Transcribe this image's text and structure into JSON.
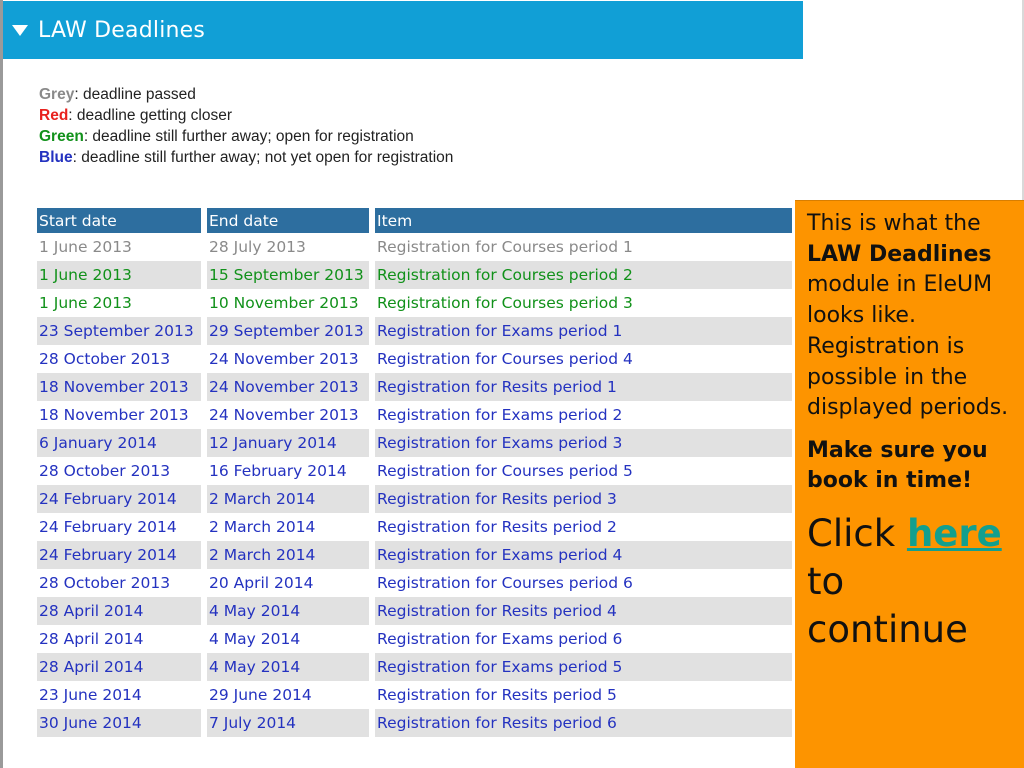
{
  "module": {
    "title": "LAW Deadlines"
  },
  "legend": [
    {
      "label": "Grey",
      "desc": ": deadline passed",
      "color": "#8a8a8a"
    },
    {
      "label": "Red",
      "desc": ": deadline getting closer",
      "color": "#e8221e"
    },
    {
      "label": "Green",
      "desc": ": deadline still further away; open for registration",
      "color": "#11911a"
    },
    {
      "label": "Blue",
      "desc": ": deadline still further away; not yet open for registration",
      "color": "#2432c0"
    }
  ],
  "table": {
    "headers": [
      "Start date",
      "End date",
      "Item"
    ],
    "header_color": "#2d6e9f",
    "rows": [
      {
        "start": "1 June 2013",
        "end": "28 July 2013",
        "item": "Registration for Courses period 1",
        "status": "grey"
      },
      {
        "start": "1 June 2013",
        "end": "15 September 2013",
        "item": "Registration for Courses period 2",
        "status": "green"
      },
      {
        "start": "1 June 2013",
        "end": "10 November 2013",
        "item": "Registration for Courses period 3",
        "status": "green"
      },
      {
        "start": "23 September 2013",
        "end": "29 September 2013",
        "item": "Registration for Exams period 1",
        "status": "blue"
      },
      {
        "start": "28 October 2013",
        "end": "24 November 2013",
        "item": "Registration for Courses period 4",
        "status": "blue"
      },
      {
        "start": "18 November 2013",
        "end": "24 November 2013",
        "item": "Registration for Resits period 1",
        "status": "blue"
      },
      {
        "start": "18 November 2013",
        "end": "24 November 2013",
        "item": "Registration for Exams period 2",
        "status": "blue"
      },
      {
        "start": "6 January 2014",
        "end": "12 January 2014",
        "item": "Registration for Exams period 3",
        "status": "blue"
      },
      {
        "start": "28 October 2013",
        "end": "16 February 2014",
        "item": "Registration for Courses period 5",
        "status": "blue"
      },
      {
        "start": "24 February 2014",
        "end": "2 March 2014",
        "item": "Registration for Resits period 3",
        "status": "blue"
      },
      {
        "start": "24 February 2014",
        "end": "2 March 2014",
        "item": "Registration for Resits period 2",
        "status": "blue"
      },
      {
        "start": "24 February 2014",
        "end": "2 March 2014",
        "item": "Registration for Exams period 4",
        "status": "blue"
      },
      {
        "start": "28 October 2013",
        "end": "20 April 2014",
        "item": "Registration for Courses period 6",
        "status": "blue"
      },
      {
        "start": "28 April 2014",
        "end": "4 May 2014",
        "item": "Registration for Resits period 4",
        "status": "blue"
      },
      {
        "start": "28 April 2014",
        "end": "4 May 2014",
        "item": "Registration for Exams period 6",
        "status": "blue"
      },
      {
        "start": "28 April 2014",
        "end": "4 May 2014",
        "item": "Registration for Exams period 5",
        "status": "blue"
      },
      {
        "start": "23 June 2014",
        "end": "29 June 2014",
        "item": "Registration for Resits period 5",
        "status": "blue"
      },
      {
        "start": "30 June 2014",
        "end": "7 July 2014",
        "item": "Registration for Resits period 6",
        "status": "blue"
      }
    ]
  },
  "callout": {
    "line1_pre": "This is what the ",
    "line1_bold": "LAW Deadlines",
    "line1_post": " module in EleUM looks like. Registration is possible in the displayed periods.",
    "emphasis": "Make sure you book in time!",
    "cta_pre": "Click ",
    "cta_link": "here",
    "cta_post": " to continue",
    "background": "#fd9400",
    "link_color": "#139f8e"
  },
  "colors": {
    "header_bar": "#119fd6",
    "row_alt": "#e1e1e1"
  }
}
